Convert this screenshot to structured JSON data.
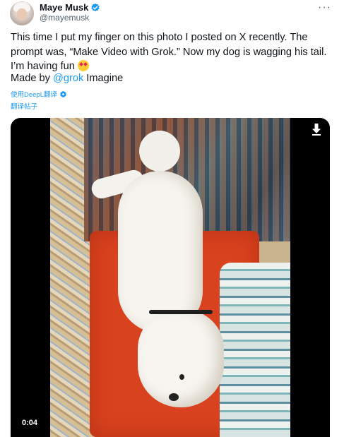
{
  "author": {
    "display_name": "Maye Musk",
    "handle": "@mayemusk"
  },
  "post": {
    "text": "This time I put my finger on this photo I posted on X recently. The prompt was, “Make Video with Grok.” Now my dog is wagging his tail. I’m having fun",
    "made_by_prefix": "Made by ",
    "made_by_mention": "@grok",
    "made_by_suffix": " Imagine"
  },
  "translation": {
    "deepl_label": "使用DeepL翻译",
    "translate_post_label": "翻译帖子"
  },
  "video": {
    "timestamp": "0:04"
  },
  "icons": {
    "verified": "verified-badge-icon",
    "more": "more-options-icon",
    "download": "download-icon",
    "emoji": "star-struck-emoji"
  },
  "colors": {
    "link": "#1d9bf0",
    "text": "#0f1419",
    "secondary": "#536471"
  }
}
